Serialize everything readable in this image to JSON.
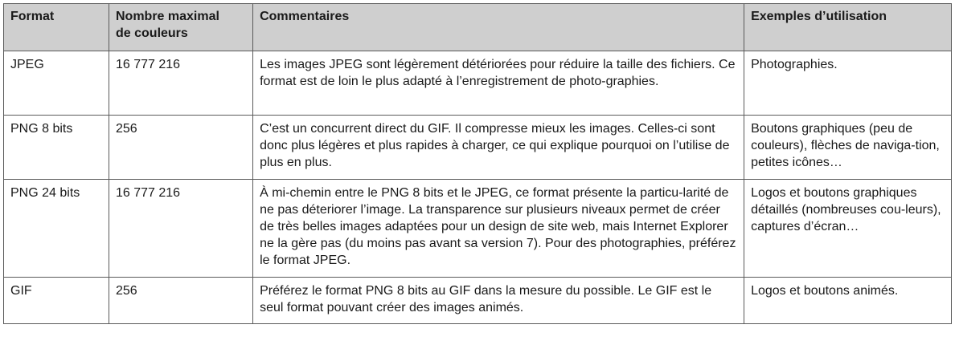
{
  "table": {
    "headers": {
      "format": "Format",
      "colors_line1": "Nombre maximal",
      "colors_line2": "de couleurs",
      "comments": "Commentaires",
      "examples": "Exemples d’utilisation"
    },
    "rows": [
      {
        "format": "JPEG",
        "colors": "16 777 216",
        "comment": "Les images JPEG sont légèrement détériorées pour réduire la taille des fichiers. Ce format est de loin le plus adapté à l’enregistrement de photo-graphies.",
        "examples": "Photographies."
      },
      {
        "format": "PNG 8 bits",
        "colors": "256",
        "comment": "C’est un concurrent direct du GIF. Il compresse mieux les images. Celles-ci sont donc plus légères et plus rapides à charger, ce qui explique pourquoi on l’utilise de plus en plus.",
        "examples": "Boutons graphiques (peu de couleurs), flèches de naviga-tion, petites icônes…"
      },
      {
        "format": "PNG 24 bits",
        "colors": "16 777 216",
        "comment": "À mi-chemin entre le PNG 8 bits et le JPEG, ce format présente la particu-larité de ne pas déteriorer l’image. La transparence sur plusieurs niveaux permet de créer de très belles images adaptées pour un design de site web, mais Internet Explorer ne la gère pas (du moins pas avant sa version 7). Pour des photographies, préférez le format JPEG.",
        "examples": "Logos et boutons graphiques détaillés (nombreuses cou-leurs), captures d’écran…"
      },
      {
        "format": "GIF",
        "colors": "256",
        "comment": "Préférez le format PNG 8 bits au GIF dans la mesure du possible. Le GIF est le seul format pouvant créer des images animés.",
        "examples": "Logos et boutons animés."
      }
    ]
  }
}
